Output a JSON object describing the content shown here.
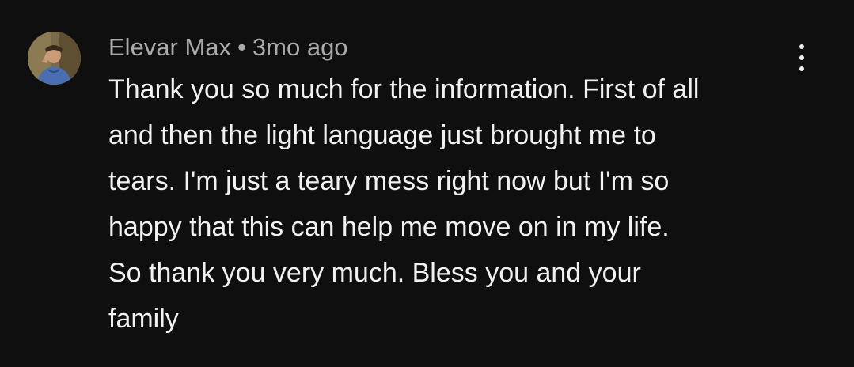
{
  "comment": {
    "author": "Elevar Max",
    "separator": "•",
    "timestamp": "3mo ago",
    "avatar_icon": "user-avatar",
    "menu_icon": "more-vertical-icon",
    "text_lines": [
      "Thank you so much for the information. First of all",
      "and then the light language just brought me to",
      "tears. I'm just a teary mess right now but I'm so",
      "happy that this can help me move on in my life.",
      "So thank you very much. Bless you and your",
      "family"
    ]
  },
  "colors": {
    "background": "#0f0f0f",
    "primary_text": "#f1f1f1",
    "secondary_text": "#aaaaaa"
  }
}
